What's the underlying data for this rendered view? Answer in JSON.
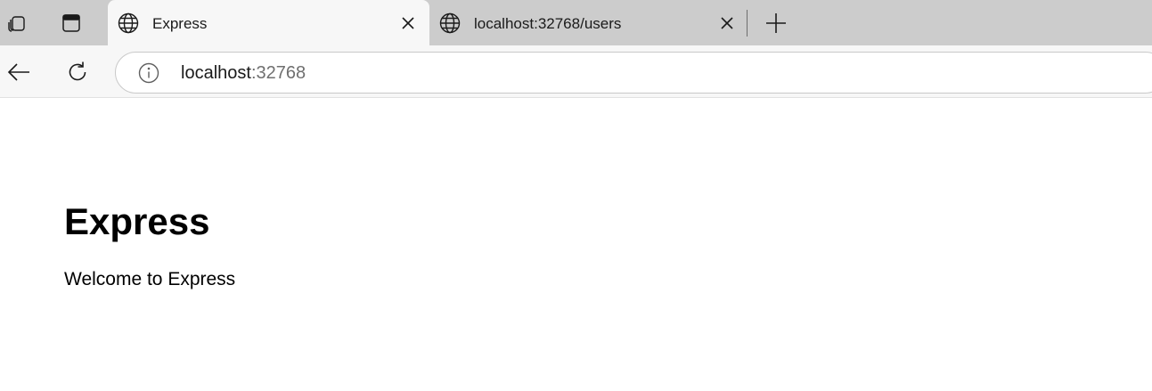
{
  "browser": {
    "tabs": [
      {
        "title": "Express",
        "active": true,
        "icon": "globe-icon"
      },
      {
        "title": "localhost:32768/users",
        "active": false,
        "icon": "globe-icon"
      }
    ],
    "address_bar": {
      "host": "localhost",
      "port": ":32768",
      "icon": "info-icon"
    },
    "strip_icons": [
      "workspaces-icon",
      "tab-actions-icon"
    ],
    "toolbar_icons": [
      "back-arrow-icon",
      "refresh-icon"
    ],
    "colors": {
      "tabstrip": "#cccccc",
      "active_tab": "#f7f7f7",
      "page_background": "#ffffff"
    }
  },
  "page": {
    "heading": "Express",
    "message": "Welcome to Express"
  }
}
